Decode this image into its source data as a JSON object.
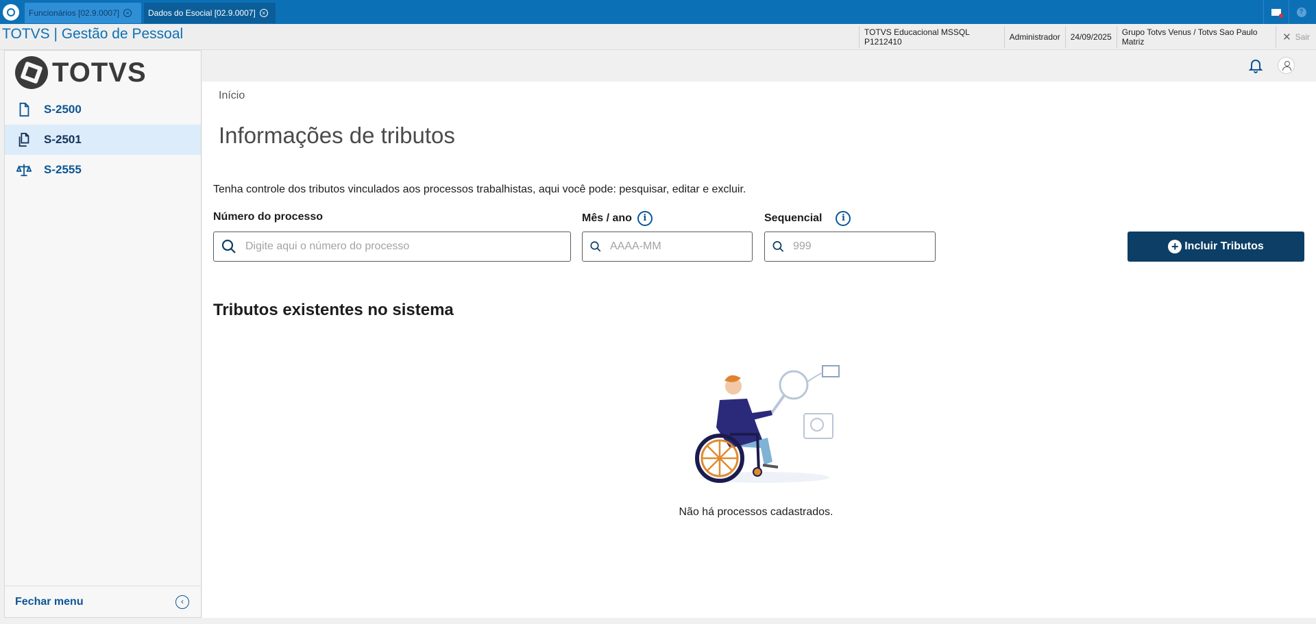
{
  "tabs": [
    {
      "label": "Funcionários [02.9.0007]",
      "active": false
    },
    {
      "label": "Dados do Esocial [02.9.0007]",
      "active": true
    }
  ],
  "header": {
    "app_title": "TOTVS | Gestão de Pessoal",
    "environment": "TOTVS Educacional MSSQL P1212410",
    "user": "Administrador",
    "date": "24/09/2025",
    "company": "Grupo Totvs Venus / Totvs Sao Paulo Matriz",
    "exit_label": "Sair"
  },
  "sidebar": {
    "brand": "TOTVS",
    "items": [
      {
        "label": "S-2500",
        "icon": "document-icon",
        "active": false
      },
      {
        "label": "S-2501",
        "icon": "copy-documents-icon",
        "active": true
      },
      {
        "label": "S-2555",
        "icon": "balance-scale-icon",
        "active": false
      }
    ],
    "close_label": "Fechar menu"
  },
  "main": {
    "breadcrumb": "Início",
    "title": "Informações de tributos",
    "description": "Tenha controle dos tributos vinculados aos processos trabalhistas, aqui você pode: pesquisar, editar e excluir.",
    "fields": {
      "process": {
        "label": "Número do processo",
        "placeholder": "Digite aqui o número do processo",
        "value": ""
      },
      "month_year": {
        "label": "Mês / ano",
        "placeholder": "AAAA-MM",
        "value": ""
      },
      "sequential": {
        "label": "Sequencial",
        "placeholder": "999",
        "value": ""
      }
    },
    "add_button_label": "Incluir Tributos",
    "section_title": "Tributos existentes no sistema",
    "empty_message": "Não há processos cadastrados."
  },
  "colors": {
    "tabbar": "#0c70b6",
    "primary_button": "#0c3e66",
    "nav_text": "#0c5596",
    "nav_active_bg": "#dcecfb"
  }
}
